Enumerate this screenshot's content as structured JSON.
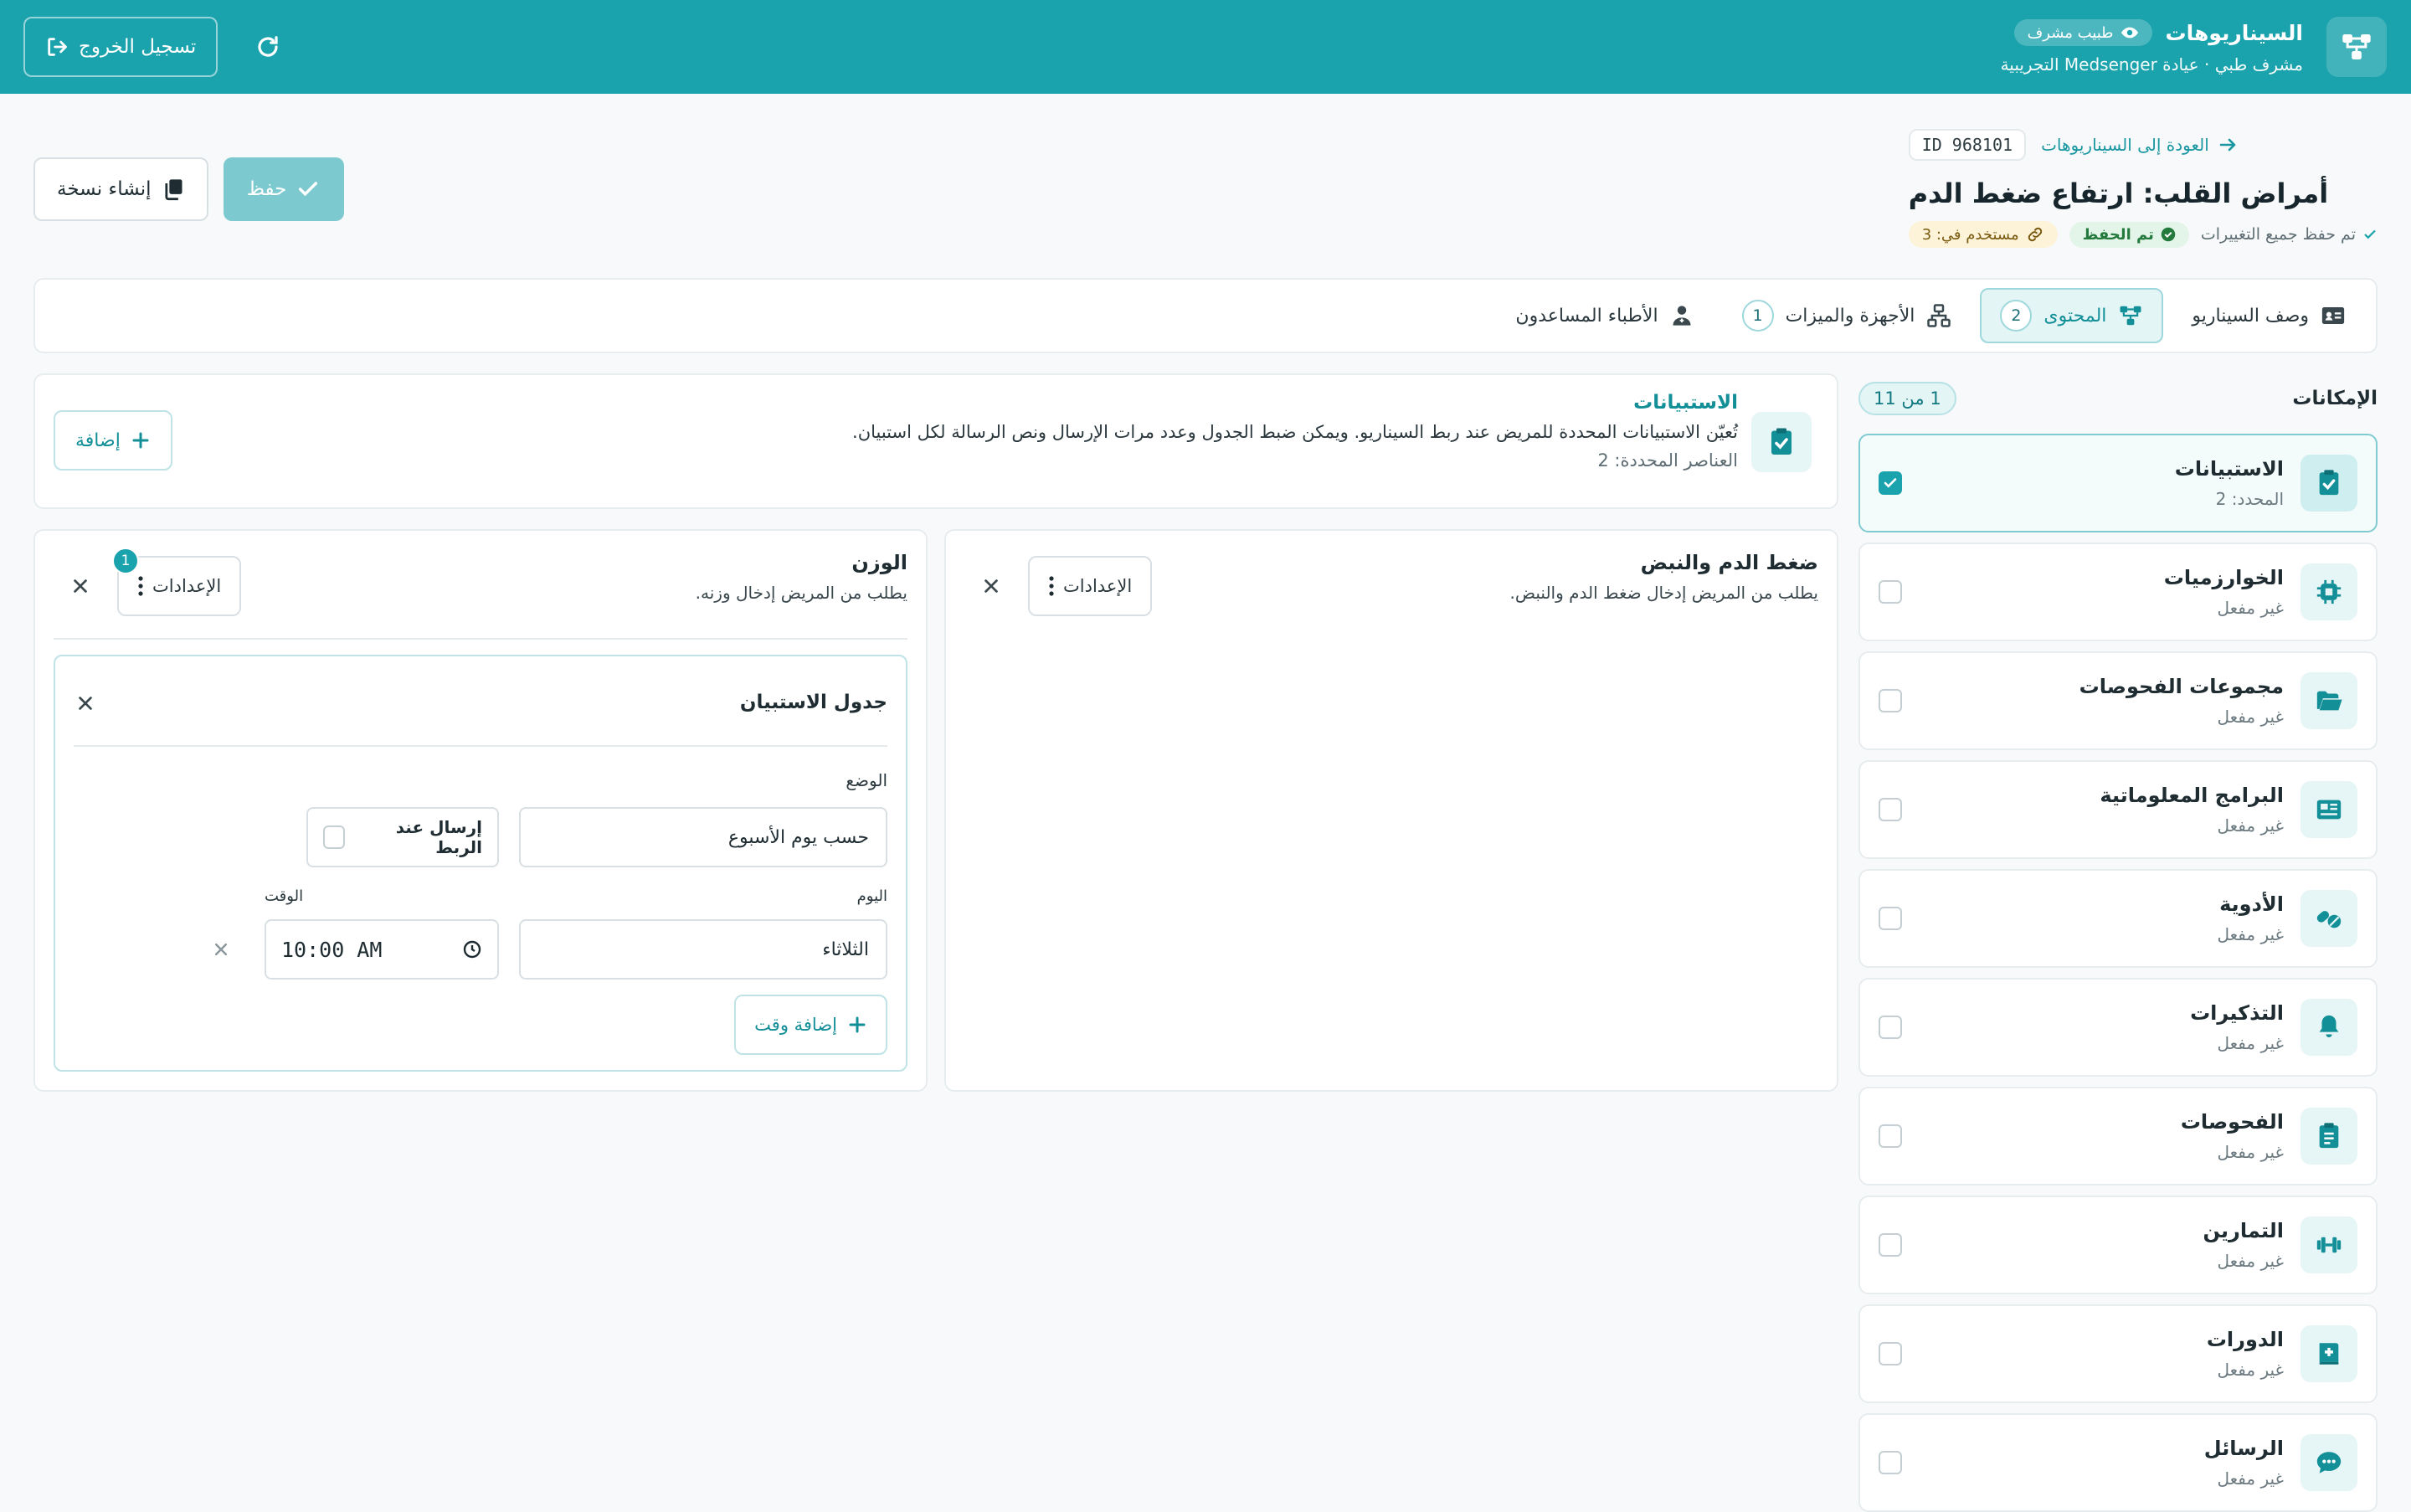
{
  "topbar": {
    "title": "السيناريوهات",
    "role": "طبيب مشرف",
    "subtitle": "مشرف طبي · عيادة Medsenger التجريبية",
    "logout_label": "تسجيل الخروج",
    "bg_color": "#1aa3ad"
  },
  "header": {
    "back_label": "العودة إلى السيناريوهات",
    "id_label": "ID 968101",
    "title": "أمراض القلب: ارتفاع ضغط الدم",
    "saved_note": "تم حفظ جميع التغييرات",
    "saved_badge": "تم الحفظ",
    "used_in": "مستخدم في: 3",
    "copy_label": "إنشاء نسخة",
    "save_label": "حفظ"
  },
  "tabs": [
    {
      "label": "وصف السيناريو",
      "count": "",
      "icon": "id-card-icon",
      "active": false
    },
    {
      "label": "المحتوى",
      "count": "2",
      "icon": "diagram-icon",
      "active": true
    },
    {
      "label": "الأجهزة والميزات",
      "count": "1",
      "icon": "network-icon",
      "active": false
    },
    {
      "label": "الأطباء المساعدون",
      "count": "",
      "icon": "doctor-icon",
      "active": false
    }
  ],
  "sidebar": {
    "title": "الإمكانات",
    "count": "1 من 11",
    "items": [
      {
        "name": "الاستبيانات",
        "status": "المحدد: 2",
        "icon": "clipboard-check-icon",
        "checked": true
      },
      {
        "name": "الخوارزميات",
        "status": "غير مفعل",
        "icon": "chip-icon",
        "checked": false
      },
      {
        "name": "مجموعات الفحوصات",
        "status": "غير مفعل",
        "icon": "folder-open-icon",
        "checked": false
      },
      {
        "name": "البرامج المعلوماتية",
        "status": "غير مفعل",
        "icon": "newspaper-icon",
        "checked": false
      },
      {
        "name": "الأدوية",
        "status": "غير مفعل",
        "icon": "pills-icon",
        "checked": false
      },
      {
        "name": "التذكيرات",
        "status": "غير مفعل",
        "icon": "bell-icon",
        "checked": false
      },
      {
        "name": "الفحوصات",
        "status": "غير مفعل",
        "icon": "clipboard-list-icon",
        "checked": false
      },
      {
        "name": "التمارين",
        "status": "غير مفعل",
        "icon": "dumbbell-icon",
        "checked": false
      },
      {
        "name": "الدورات",
        "status": "غير مفعل",
        "icon": "book-medical-icon",
        "checked": false
      },
      {
        "name": "الرسائل",
        "status": "غير مفعل",
        "icon": "comment-dots-icon",
        "checked": false
      }
    ]
  },
  "intro": {
    "title": "الاستبيانات",
    "description": "تُعيّن الاستبيانات المحددة للمريض عند ربط السيناريو. ويمكن ضبط الجدول وعدد مرات الإرسال ونص الرسالة لكل استبيان.",
    "count_text": "العناصر المحددة: 2",
    "add_label": "إضافة"
  },
  "questionnaires": {
    "bp": {
      "title": "ضغط الدم والنبض",
      "description": "يطلب من المريض إدخال ضغط الدم والنبض.",
      "settings_label": "الإعدادات"
    },
    "weight": {
      "title": "الوزن",
      "description": "يطلب من المريض إدخال وزنه.",
      "settings_label": "الإعدادات",
      "settings_badge": "1"
    }
  },
  "schedule": {
    "title": "جدول الاستبيان",
    "mode_label": "الوضع",
    "mode_value": "حسب يوم الأسبوع",
    "send_on_link": "إرسال عند الربط",
    "day_label": "اليوم",
    "day_value": "الثلاثاء",
    "time_label": "الوقت",
    "time_value": "10:00 AM",
    "add_time_label": "إضافة وقت"
  }
}
